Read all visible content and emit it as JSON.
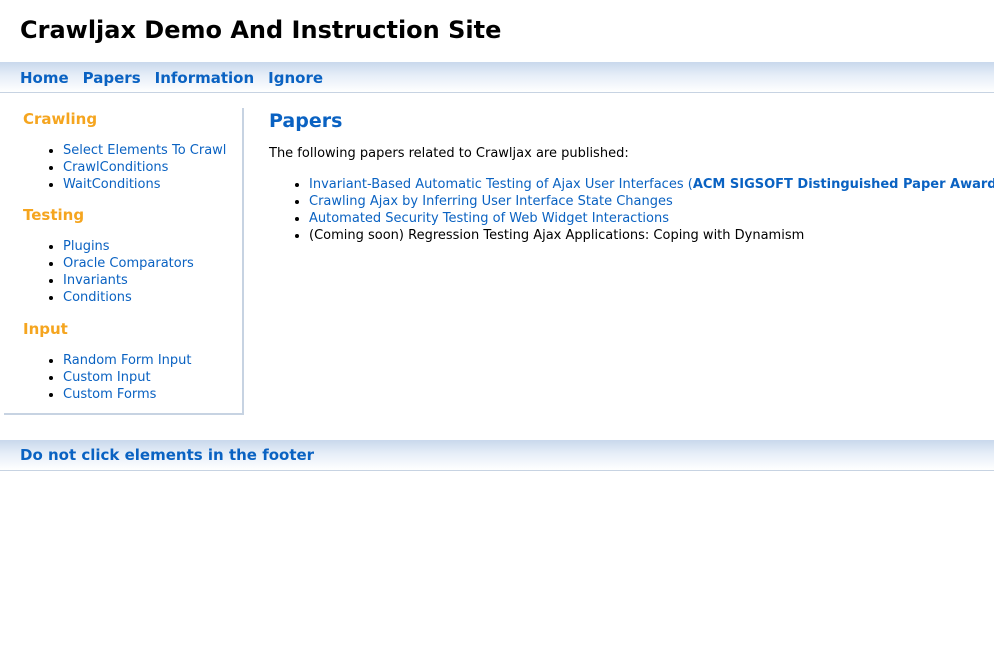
{
  "site": {
    "title": "Crawljax Demo And Instruction Site"
  },
  "nav": {
    "items": [
      {
        "label": "Home"
      },
      {
        "label": "Papers"
      },
      {
        "label": "Information"
      },
      {
        "label": "Ignore"
      }
    ]
  },
  "sidebar": {
    "sections": [
      {
        "heading": "Crawling",
        "links": [
          "Select Elements To Crawl",
          "CrawlConditions",
          "WaitConditions"
        ]
      },
      {
        "heading": "Testing",
        "links": [
          "Plugins",
          "Oracle Comparators",
          "Invariants",
          "Conditions"
        ]
      },
      {
        "heading": "Input",
        "links": [
          "Random Form Input",
          "Custom Input",
          "Custom Forms"
        ]
      }
    ]
  },
  "main": {
    "heading": "Papers",
    "intro": "The following papers related to Crawljax are published:",
    "papers": [
      {
        "title": "Invariant-Based Automatic Testing of Ajax User Interfaces (",
        "award": "ACM SIGSOFT Distinguished Paper Award",
        "close": ")"
      },
      {
        "title": "Crawling Ajax by Inferring User Interface State Changes"
      },
      {
        "title": "Automated Security Testing of Web Widget Interactions"
      },
      {
        "title": "(Coming soon) Regression Testing Ajax Applications: Coping with Dynamism"
      }
    ]
  },
  "footer": {
    "link": "Do not click elements in the footer"
  },
  "colors": {
    "link": "#0a62c2",
    "sidebar_heading": "#f5a51f",
    "bar_gradient_top": "#c9d8ec",
    "divider": "#c7d3e2"
  }
}
